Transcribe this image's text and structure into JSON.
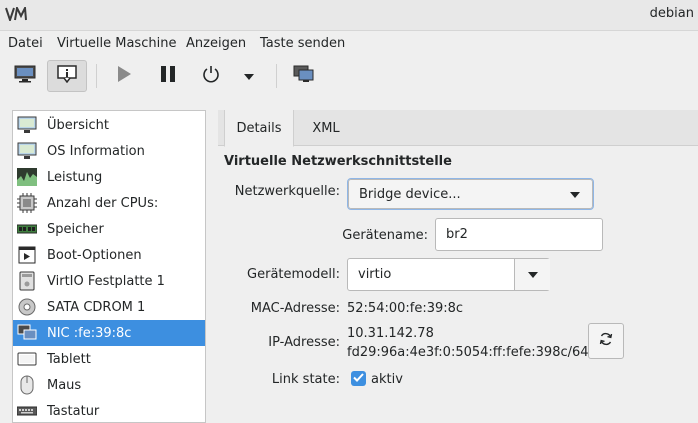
{
  "window": {
    "title": "debian"
  },
  "menu": [
    "Datei",
    "Virtuelle Maschine",
    "Anzeigen",
    "Taste senden"
  ],
  "toolbar": {
    "buttons": [
      "monitor-icon",
      "info-icon",
      "play-icon",
      "pause-icon",
      "power-icon",
      "chevron-down-icon",
      "screenshot-icon"
    ]
  },
  "sidebar": {
    "items": [
      {
        "label": "Übersicht",
        "icon": "overview-icon"
      },
      {
        "label": "OS Information",
        "icon": "os-info-icon"
      },
      {
        "label": "Leistung",
        "icon": "performance-icon"
      },
      {
        "label": "Anzahl der CPUs:",
        "icon": "cpu-icon"
      },
      {
        "label": "Speicher",
        "icon": "memory-icon"
      },
      {
        "label": "Boot-Optionen",
        "icon": "boot-icon"
      },
      {
        "label": "VirtIO Festplatte 1",
        "icon": "disk-icon"
      },
      {
        "label": "SATA CDROM 1",
        "icon": "cdrom-icon"
      },
      {
        "label": "NIC :fe:39:8c",
        "icon": "nic-icon"
      },
      {
        "label": "Tablett",
        "icon": "tablet-icon"
      },
      {
        "label": "Maus",
        "icon": "mouse-icon"
      },
      {
        "label": "Tastatur",
        "icon": "keyboard-icon"
      }
    ],
    "selected_index": 8
  },
  "tabs": [
    "Details",
    "XML"
  ],
  "details": {
    "section_title": "Virtuelle Netzwerkschnittstelle",
    "network_source_label": "Netzwerkquelle:",
    "network_source_value": "Bridge device...",
    "device_name_label": "Gerätename:",
    "device_name_value": "br2",
    "device_model_label": "Gerätemodell:",
    "device_model_value": "virtio",
    "mac_label": "MAC-Adresse:",
    "mac_value": "52:54:00:fe:39:8c",
    "ip_label": "IP-Adresse:",
    "ip_v4": "10.31.142.78",
    "ip_v6": "fd29:96a:4e3f:0:5054:ff:fefe:398c/64",
    "link_state_label": "Link state:",
    "link_state_value": "aktiv",
    "link_state_checked": true
  },
  "colors": {
    "accent": "#3d8fe0"
  }
}
